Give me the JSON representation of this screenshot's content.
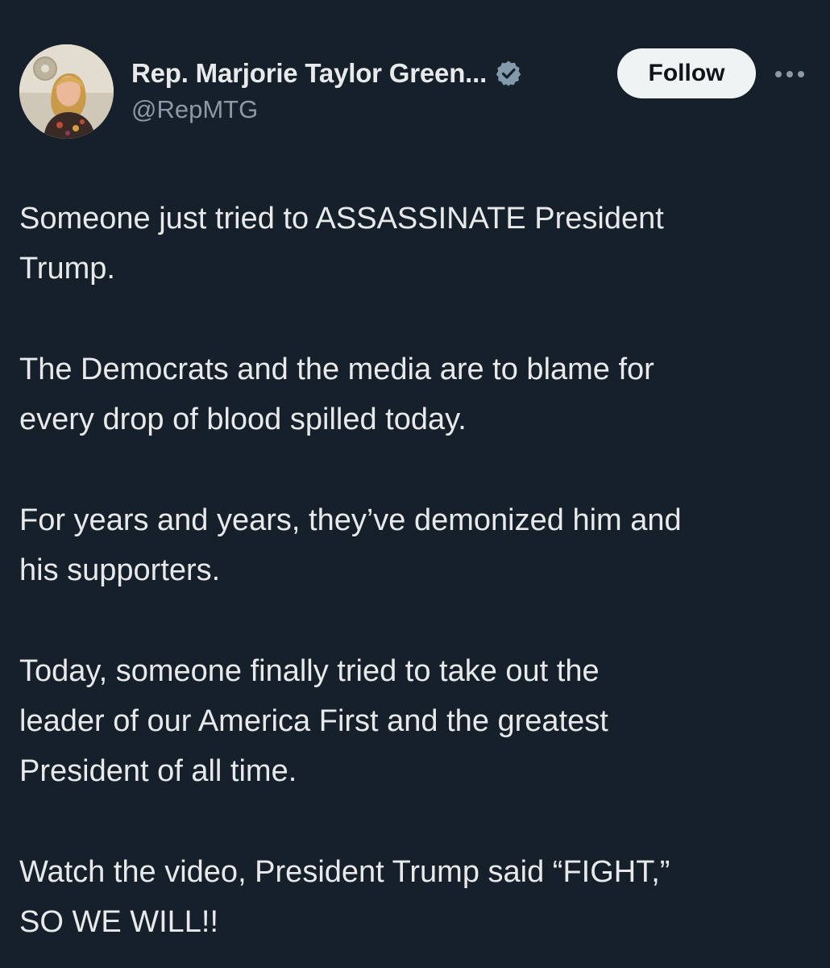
{
  "author": {
    "display_name": "Rep. Marjorie Taylor Green...",
    "handle": "@RepMTG",
    "verified_icon": "verified-badge-icon",
    "verified_color": "#829aab"
  },
  "actions": {
    "follow_label": "Follow",
    "more_icon": "more-options-icon"
  },
  "tweet": {
    "paragraphs": [
      "Someone just tried to ASSASSINATE President\nTrump.",
      "The Democrats and the media are to blame for\nevery drop of blood spilled today.",
      "For years and years, they’ve demonized him and\nhis supporters.",
      "Today, someone finally tried to take out the\nleader of our America First and the greatest\nPresident of all time.",
      "Watch the video, President Trump said “FIGHT,”\nSO WE WILL!!"
    ]
  },
  "colors": {
    "background": "#16202b",
    "text": "#e7e9ea",
    "secondary_text": "#8b98a5",
    "follow_bg": "#eff3f4"
  }
}
